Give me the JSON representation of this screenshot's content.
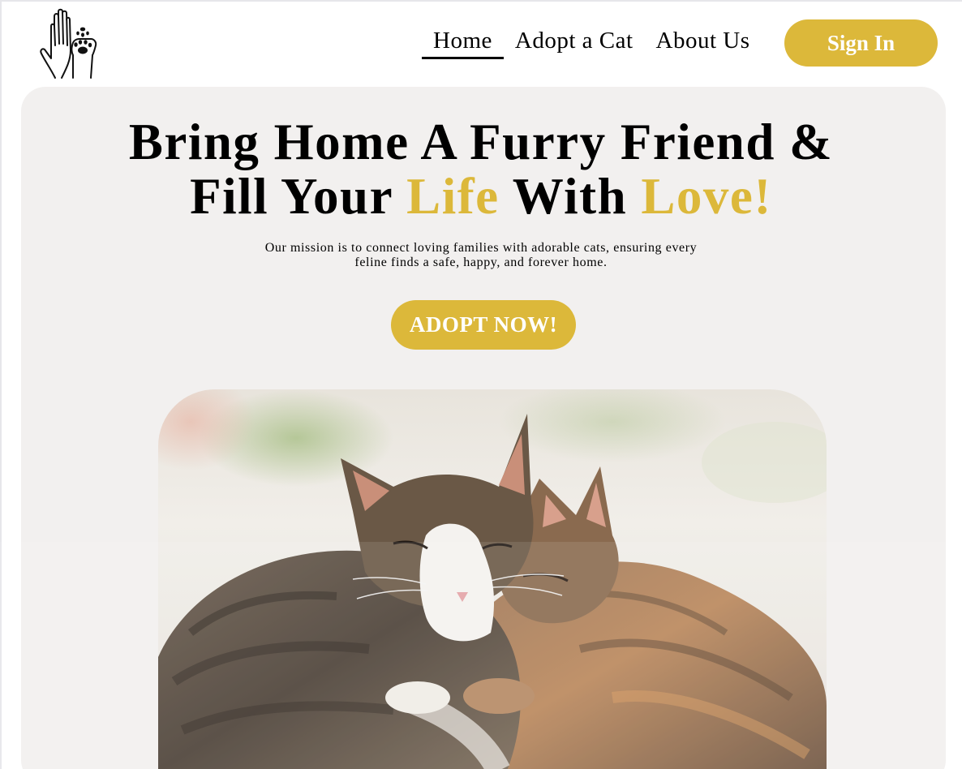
{
  "nav": {
    "items": [
      {
        "label": "Home",
        "active": true
      },
      {
        "label": "Adopt a Cat",
        "active": false
      },
      {
        "label": "About Us",
        "active": false
      }
    ],
    "signin_label": "Sign In"
  },
  "logo": {
    "icon": "hand-and-paw-icon"
  },
  "hero": {
    "title_line1": "Bring Home A Furry Friend &",
    "title_line2_a": "Fill Your ",
    "title_line2_b": "Life",
    "title_line2_c": " With ",
    "title_line2_d": "Love!",
    "subtitle_line1": "Our mission is to connect loving families with adorable cats, ensuring every",
    "subtitle_line2": "feline finds a safe, happy, and forever home.",
    "cta_label": "ADOPT NOW!",
    "image": "two-cats-cuddling-photo"
  },
  "colors": {
    "accent": "#dcb83a",
    "panel": "#f2f0ef",
    "text": "#000000"
  }
}
